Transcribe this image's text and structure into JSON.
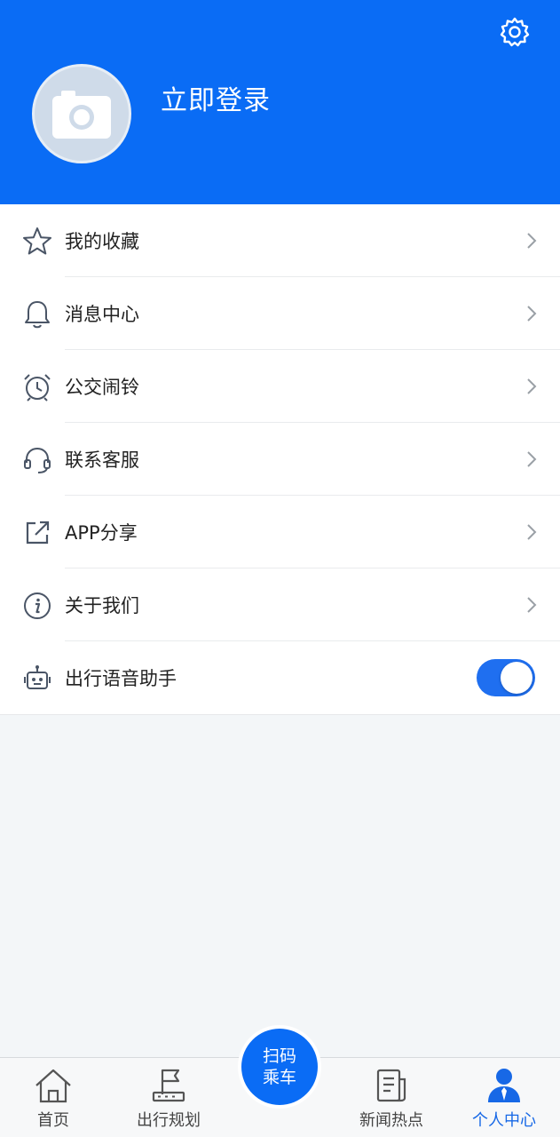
{
  "header": {
    "login_text": "立即登录"
  },
  "menu": {
    "items": [
      {
        "label": "我的收藏",
        "icon": "star-icon"
      },
      {
        "label": "消息中心",
        "icon": "bell-icon"
      },
      {
        "label": "公交闹铃",
        "icon": "alarm-clock-icon"
      },
      {
        "label": "联系客服",
        "icon": "headset-icon"
      },
      {
        "label": "APP分享",
        "icon": "share-icon"
      },
      {
        "label": "关于我们",
        "icon": "info-icon"
      }
    ],
    "voice_assistant": {
      "label": "出行语音助手",
      "icon": "robot-icon",
      "enabled": true
    }
  },
  "tabbar": {
    "home": "首页",
    "plan": "出行规划",
    "scan_line1": "扫码",
    "scan_line2": "乘车",
    "news": "新闻热点",
    "profile": "个人中心"
  },
  "colors": {
    "primary": "#0a6cf5",
    "active_tab": "#1768e6",
    "background": "#f3f6f8"
  }
}
